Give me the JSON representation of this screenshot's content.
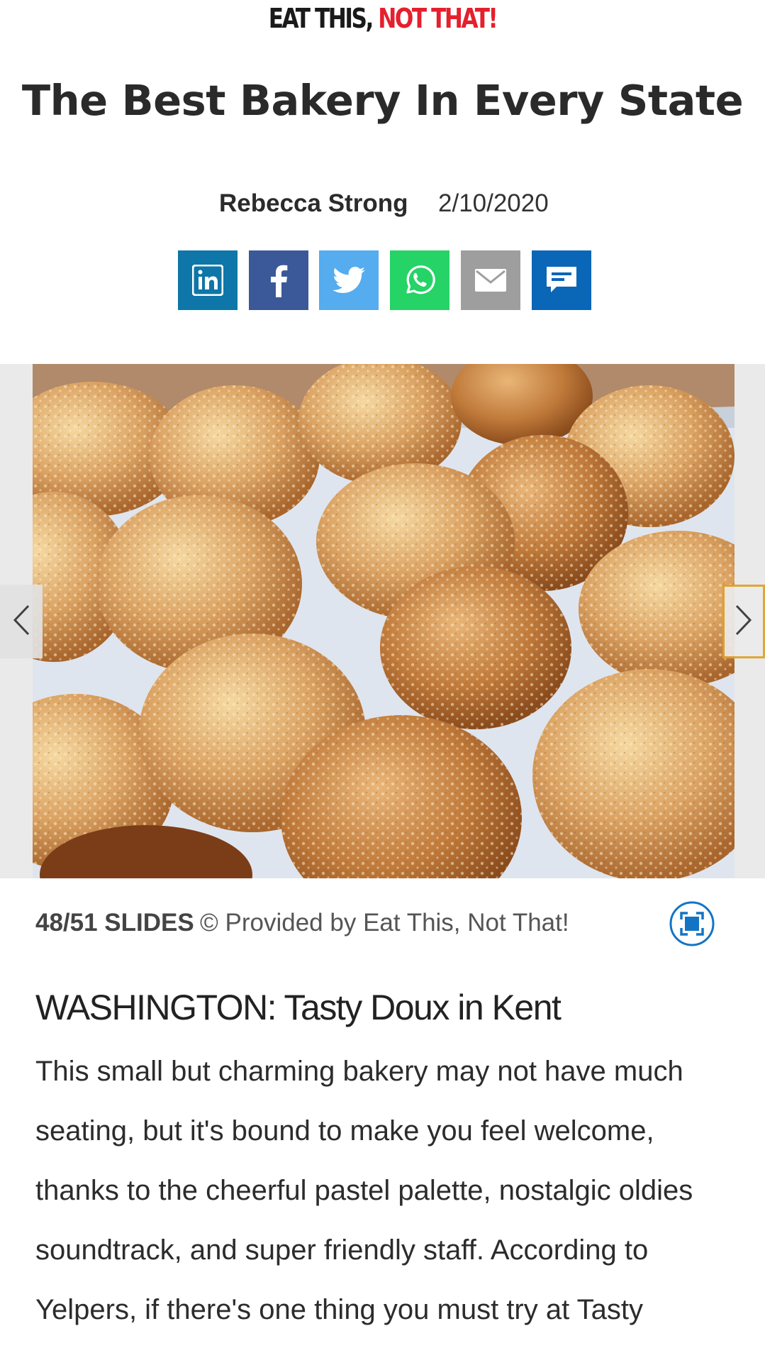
{
  "header": {
    "logo_part1": "EAT THIS, ",
    "logo_part2": "NOT THAT!",
    "brand_colors": {
      "black": "#1a1a1a",
      "red": "#e4202e"
    }
  },
  "article": {
    "title": "The Best Bakery In Every State",
    "author": "Rebecca Strong",
    "date": "2/10/2020"
  },
  "share": [
    {
      "name": "linkedin-share-button",
      "icon": "linkedin-icon",
      "color": "#0e76a8"
    },
    {
      "name": "facebook-share-button",
      "icon": "facebook-icon",
      "color": "#3b5998"
    },
    {
      "name": "twitter-share-button",
      "icon": "twitter-icon",
      "color": "#55acee"
    },
    {
      "name": "whatsapp-share-button",
      "icon": "whatsapp-icon",
      "color": "#25d366"
    },
    {
      "name": "email-share-button",
      "icon": "email-icon",
      "color": "#9e9e9e"
    },
    {
      "name": "comment-button",
      "icon": "comment-icon",
      "color": "#0a66b7"
    }
  ],
  "gallery": {
    "prev_icon": "chevron-left-icon",
    "next_icon": "chevron-right-icon",
    "slide_counter": "48/51 SLIDES",
    "credit": "© Provided by Eat This, Not That!",
    "expand_icon": "fullscreen-icon"
  },
  "section": {
    "heading": "WASHINGTON: Tasty Doux in Kent",
    "body": "This small but charming bakery may not have much seating, but it's bound to make you feel welcome, thanks to the cheerful pastel palette, nostalgic oldies soundtrack, and super friendly staff. According to Yelpers, if there's one thing you must try at Tasty"
  }
}
